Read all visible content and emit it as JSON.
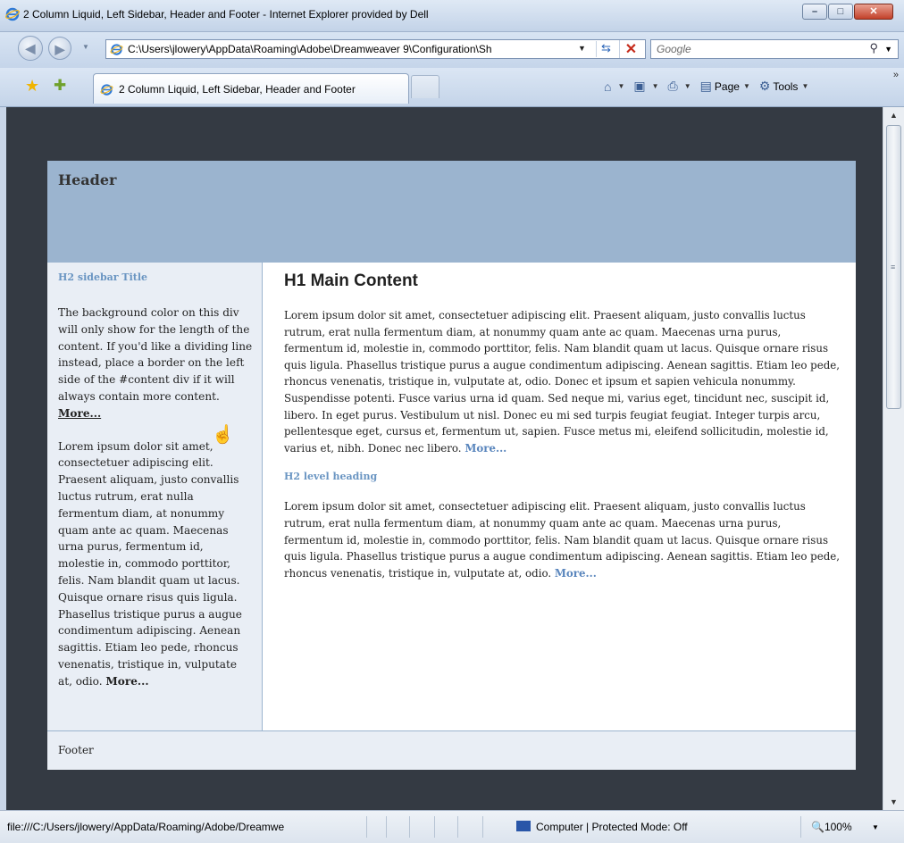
{
  "window": {
    "title": "2 Column Liquid, Left Sidebar, Header and Footer - Internet Explorer provided by Dell",
    "min_label": "–",
    "max_label": "□",
    "close_label": "✕"
  },
  "address_bar": {
    "url": "C:\\Users\\jlowery\\AppData\\Roaming\\Adobe\\Dreamweaver 9\\Configuration\\Sh",
    "search_placeholder": "Google"
  },
  "tabs": [
    {
      "label": "2 Column Liquid, Left Sidebar, Header and Footer"
    }
  ],
  "command_bar": {
    "page_label": "Page",
    "tools_label": "Tools"
  },
  "page": {
    "header_title": "Header",
    "sidebar": {
      "title": "H2 sidebar Title",
      "para1": "The background color on this div will only show for the length of the content. If you'd like a dividing line instead, place a border on the left side of the #content div if it will always contain more content. ",
      "para1_more": "More...",
      "para2": "Lorem ipsum dolor sit amet, consectetuer adipiscing elit. Praesent aliquam, justo convallis luctus rutrum, erat nulla fermentum diam, at nonummy quam ante ac quam. Maecenas urna purus, fermentum id, molestie in, commodo porttitor, felis. Nam blandit quam ut lacus. Quisque ornare risus quis ligula. Phasellus tristique purus a augue condimentum adipiscing. Aenean sagittis. Etiam leo pede, rhoncus venenatis, tristique in, vulputate at, odio. ",
      "para2_more": "More..."
    },
    "main": {
      "h1": "H1 Main Content",
      "para1": "Lorem ipsum dolor sit amet, consectetuer adipiscing elit. Praesent aliquam, justo convallis luctus rutrum, erat nulla fermentum diam, at nonummy quam ante ac quam. Maecenas urna purus, fermentum id, molestie in, commodo porttitor, felis. Nam blandit quam ut lacus. Quisque ornare risus quis ligula. Phasellus tristique purus a augue condimentum adipiscing. Aenean sagittis. Etiam leo pede, rhoncus venenatis, tristique in, vulputate at, odio. Donec et ipsum et sapien vehicula nonummy. Suspendisse potenti. Fusce varius urna id quam. Sed neque mi, varius eget, tincidunt nec, suscipit id, libero. In eget purus. Vestibulum ut nisl. Donec eu mi sed turpis feugiat feugiat. Integer turpis arcu, pellentesque eget, cursus et, fermentum ut, sapien. Fusce metus mi, eleifend sollicitudin, molestie id, varius et, nibh. Donec nec libero. ",
      "para1_more": "More...",
      "h2": "H2 level heading",
      "para2": "Lorem ipsum dolor sit amet, consectetuer adipiscing elit. Praesent aliquam, justo convallis luctus rutrum, erat nulla fermentum diam, at nonummy quam ante ac quam. Maecenas urna purus, fermentum id, molestie in, commodo porttitor, felis. Nam blandit quam ut lacus. Quisque ornare risus quis ligula. Phasellus tristique purus a augue condimentum adipiscing. Aenean sagittis. Etiam leo pede, rhoncus venenatis, tristique in, vulputate at, odio. ",
      "para2_more": "More..."
    },
    "footer": "Footer"
  },
  "status_bar": {
    "text": "file:///C:/Users/jlowery/AppData/Roaming/Adobe/Dreamwe",
    "zone": "Computer | Protected Mode: Off",
    "zoom": "100%"
  },
  "icons": {
    "zoom_icon": "🔍"
  }
}
